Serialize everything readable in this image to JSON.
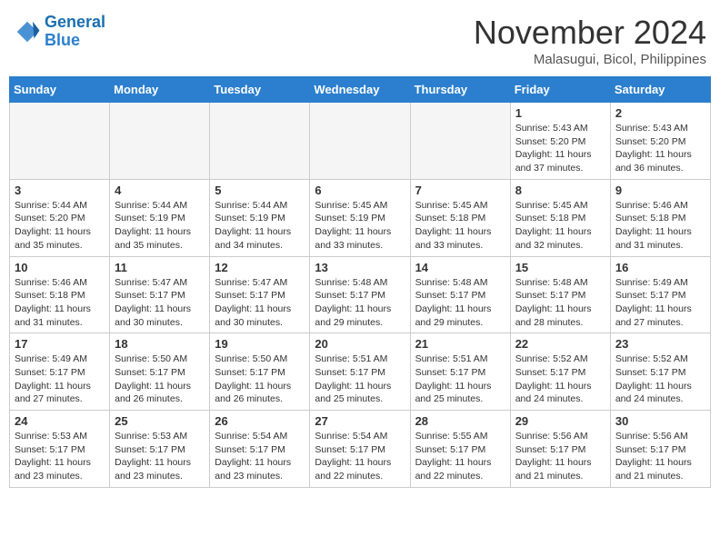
{
  "header": {
    "logo_line1": "General",
    "logo_line2": "Blue",
    "month_title": "November 2024",
    "location": "Malasugui, Bicol, Philippines"
  },
  "days_of_week": [
    "Sunday",
    "Monday",
    "Tuesday",
    "Wednesday",
    "Thursday",
    "Friday",
    "Saturday"
  ],
  "weeks": [
    [
      {
        "day": "",
        "empty": true
      },
      {
        "day": "",
        "empty": true
      },
      {
        "day": "",
        "empty": true
      },
      {
        "day": "",
        "empty": true
      },
      {
        "day": "",
        "empty": true
      },
      {
        "day": "1",
        "sunrise": "5:43 AM",
        "sunset": "5:20 PM",
        "daylight": "11 hours and 37 minutes."
      },
      {
        "day": "2",
        "sunrise": "5:43 AM",
        "sunset": "5:20 PM",
        "daylight": "11 hours and 36 minutes."
      }
    ],
    [
      {
        "day": "3",
        "sunrise": "5:44 AM",
        "sunset": "5:20 PM",
        "daylight": "11 hours and 35 minutes."
      },
      {
        "day": "4",
        "sunrise": "5:44 AM",
        "sunset": "5:19 PM",
        "daylight": "11 hours and 35 minutes."
      },
      {
        "day": "5",
        "sunrise": "5:44 AM",
        "sunset": "5:19 PM",
        "daylight": "11 hours and 34 minutes."
      },
      {
        "day": "6",
        "sunrise": "5:45 AM",
        "sunset": "5:19 PM",
        "daylight": "11 hours and 33 minutes."
      },
      {
        "day": "7",
        "sunrise": "5:45 AM",
        "sunset": "5:18 PM",
        "daylight": "11 hours and 33 minutes."
      },
      {
        "day": "8",
        "sunrise": "5:45 AM",
        "sunset": "5:18 PM",
        "daylight": "11 hours and 32 minutes."
      },
      {
        "day": "9",
        "sunrise": "5:46 AM",
        "sunset": "5:18 PM",
        "daylight": "11 hours and 31 minutes."
      }
    ],
    [
      {
        "day": "10",
        "sunrise": "5:46 AM",
        "sunset": "5:18 PM",
        "daylight": "11 hours and 31 minutes."
      },
      {
        "day": "11",
        "sunrise": "5:47 AM",
        "sunset": "5:17 PM",
        "daylight": "11 hours and 30 minutes."
      },
      {
        "day": "12",
        "sunrise": "5:47 AM",
        "sunset": "5:17 PM",
        "daylight": "11 hours and 30 minutes."
      },
      {
        "day": "13",
        "sunrise": "5:48 AM",
        "sunset": "5:17 PM",
        "daylight": "11 hours and 29 minutes."
      },
      {
        "day": "14",
        "sunrise": "5:48 AM",
        "sunset": "5:17 PM",
        "daylight": "11 hours and 29 minutes."
      },
      {
        "day": "15",
        "sunrise": "5:48 AM",
        "sunset": "5:17 PM",
        "daylight": "11 hours and 28 minutes."
      },
      {
        "day": "16",
        "sunrise": "5:49 AM",
        "sunset": "5:17 PM",
        "daylight": "11 hours and 27 minutes."
      }
    ],
    [
      {
        "day": "17",
        "sunrise": "5:49 AM",
        "sunset": "5:17 PM",
        "daylight": "11 hours and 27 minutes."
      },
      {
        "day": "18",
        "sunrise": "5:50 AM",
        "sunset": "5:17 PM",
        "daylight": "11 hours and 26 minutes."
      },
      {
        "day": "19",
        "sunrise": "5:50 AM",
        "sunset": "5:17 PM",
        "daylight": "11 hours and 26 minutes."
      },
      {
        "day": "20",
        "sunrise": "5:51 AM",
        "sunset": "5:17 PM",
        "daylight": "11 hours and 25 minutes."
      },
      {
        "day": "21",
        "sunrise": "5:51 AM",
        "sunset": "5:17 PM",
        "daylight": "11 hours and 25 minutes."
      },
      {
        "day": "22",
        "sunrise": "5:52 AM",
        "sunset": "5:17 PM",
        "daylight": "11 hours and 24 minutes."
      },
      {
        "day": "23",
        "sunrise": "5:52 AM",
        "sunset": "5:17 PM",
        "daylight": "11 hours and 24 minutes."
      }
    ],
    [
      {
        "day": "24",
        "sunrise": "5:53 AM",
        "sunset": "5:17 PM",
        "daylight": "11 hours and 23 minutes."
      },
      {
        "day": "25",
        "sunrise": "5:53 AM",
        "sunset": "5:17 PM",
        "daylight": "11 hours and 23 minutes."
      },
      {
        "day": "26",
        "sunrise": "5:54 AM",
        "sunset": "5:17 PM",
        "daylight": "11 hours and 23 minutes."
      },
      {
        "day": "27",
        "sunrise": "5:54 AM",
        "sunset": "5:17 PM",
        "daylight": "11 hours and 22 minutes."
      },
      {
        "day": "28",
        "sunrise": "5:55 AM",
        "sunset": "5:17 PM",
        "daylight": "11 hours and 22 minutes."
      },
      {
        "day": "29",
        "sunrise": "5:56 AM",
        "sunset": "5:17 PM",
        "daylight": "11 hours and 21 minutes."
      },
      {
        "day": "30",
        "sunrise": "5:56 AM",
        "sunset": "5:17 PM",
        "daylight": "11 hours and 21 minutes."
      }
    ]
  ]
}
